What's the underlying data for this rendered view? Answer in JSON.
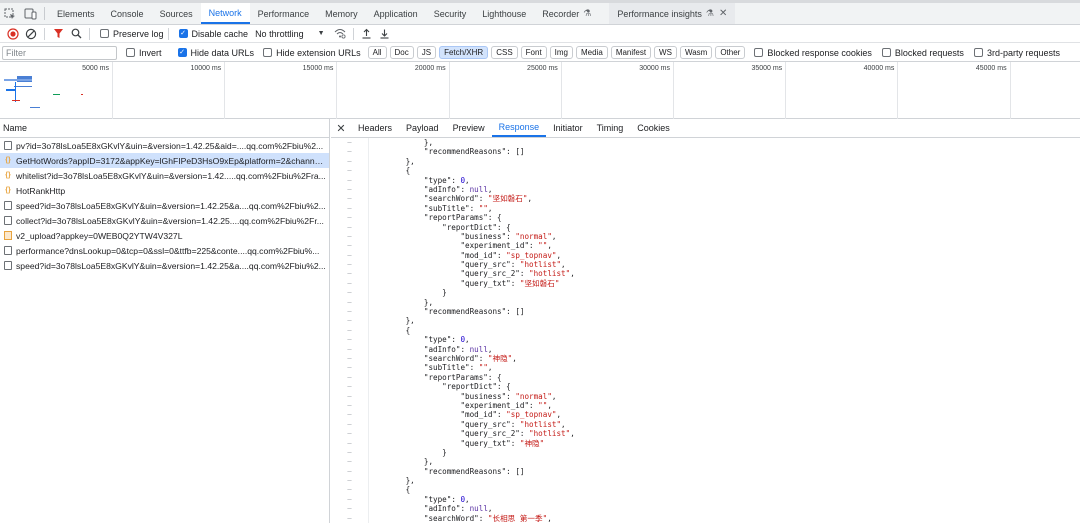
{
  "tabs": [
    {
      "label": "Elements",
      "active": false
    },
    {
      "label": "Console",
      "active": false
    },
    {
      "label": "Sources",
      "active": false
    },
    {
      "label": "Network",
      "active": true
    },
    {
      "label": "Performance",
      "active": false
    },
    {
      "label": "Memory",
      "active": false
    },
    {
      "label": "Application",
      "active": false
    },
    {
      "label": "Security",
      "active": false
    },
    {
      "label": "Lighthouse",
      "active": false
    },
    {
      "label": "Recorder",
      "active": false
    }
  ],
  "pinned_tab": {
    "label": "Performance insights"
  },
  "toolbar": {
    "preserve_log": "Preserve log",
    "disable_cache": "Disable cache",
    "throttling": "No throttling"
  },
  "filterbar": {
    "placeholder": "Filter",
    "invert": "Invert",
    "hide_data_urls": "Hide data URLs",
    "hide_extension_urls": "Hide extension URLs",
    "types": [
      "All",
      "Doc",
      "JS",
      "Fetch/XHR",
      "CSS",
      "Font",
      "Img",
      "Media",
      "Manifest",
      "WS",
      "Wasm",
      "Other"
    ],
    "active_type": "Fetch/XHR",
    "blocked_response_cookies": "Blocked response cookies",
    "blocked_requests": "Blocked requests",
    "third_party": "3rd-party requests"
  },
  "overview": {
    "ticks": [
      "5000 ms",
      "10000 ms",
      "15000 ms",
      "20000 ms",
      "25000 ms",
      "30000 ms",
      "35000 ms",
      "40000 ms",
      "45000 ms"
    ]
  },
  "requests": {
    "header": "Name",
    "items": [
      {
        "name": "pv?id=3o78lsLoa5E8xGKvlY&uin=&version=1.42.25&aid=....qq.com%2Fbiu%2...",
        "icon": "doc",
        "selected": false
      },
      {
        "name": "GetHotWords?appID=3172&appKey=lGhFIPeD3HsO9xEp&platform=2&channell...",
        "icon": "json",
        "selected": true
      },
      {
        "name": "whitelist?id=3o78lsLoa5E8xGKvlY&uin=&version=1.42.....qq.com%2Fbiu%2Fra...",
        "icon": "json",
        "selected": false
      },
      {
        "name": "HotRankHttp",
        "icon": "json",
        "selected": false
      },
      {
        "name": "speed?id=3o78lsLoa5E8xGKvlY&uin=&version=1.42.25&a....qq.com%2Fbiu%2...",
        "icon": "doc",
        "selected": false
      },
      {
        "name": "collect?id=3o78lsLoa5E8xGKvlY&uin=&version=1.42.25....qq.com%2Fbiu%2Fr...",
        "icon": "doc",
        "selected": false
      },
      {
        "name": "v2_upload?appkey=0WEB0Q2YTW4V327L",
        "icon": "img",
        "selected": false
      },
      {
        "name": "performance?dnsLookup=0&tcp=0&ssl=0&ttfb=225&conte....qq.com%2Fbiu%...",
        "icon": "doc",
        "selected": false
      },
      {
        "name": "speed?id=3o78lsLoa5E8xGKvlY&uin=&version=1.42.25&a....qq.com%2Fbiu%2...",
        "icon": "doc",
        "selected": false
      }
    ]
  },
  "detail_tabs": [
    {
      "label": "Headers",
      "active": false
    },
    {
      "label": "Payload",
      "active": false
    },
    {
      "label": "Preview",
      "active": false
    },
    {
      "label": "Response",
      "active": true
    },
    {
      "label": "Initiator",
      "active": false
    },
    {
      "label": "Timing",
      "active": false
    },
    {
      "label": "Cookies",
      "active": false
    }
  ],
  "response": {
    "gutter_mark": "–",
    "lines": [
      [
        [
          12,
          ""
        ],
        [
          "p",
          "},"
        ]
      ],
      [
        [
          12,
          ""
        ],
        [
          "k",
          "\"recommendReasons\""
        ],
        [
          "p",
          ": []"
        ]
      ],
      [
        [
          8,
          ""
        ],
        [
          "p",
          "},"
        ]
      ],
      [
        [
          8,
          ""
        ],
        [
          "p",
          "{"
        ]
      ],
      [
        [
          12,
          ""
        ],
        [
          "k",
          "\"type\""
        ],
        [
          "p",
          ": "
        ],
        [
          "n",
          "0"
        ],
        [
          "p",
          ","
        ]
      ],
      [
        [
          12,
          ""
        ],
        [
          "k",
          "\"adInfo\""
        ],
        [
          "p",
          ": "
        ],
        [
          "nl",
          "null"
        ],
        [
          "p",
          ","
        ]
      ],
      [
        [
          12,
          ""
        ],
        [
          "k",
          "\"searchWord\""
        ],
        [
          "p",
          ": "
        ],
        [
          "s",
          "\"坚如磐石\""
        ],
        [
          "p",
          ","
        ]
      ],
      [
        [
          12,
          ""
        ],
        [
          "k",
          "\"subTitle\""
        ],
        [
          "p",
          ": "
        ],
        [
          "s",
          "\"\""
        ],
        [
          "p",
          ","
        ]
      ],
      [
        [
          12,
          ""
        ],
        [
          "k",
          "\"reportParams\""
        ],
        [
          "p",
          ": {"
        ]
      ],
      [
        [
          16,
          ""
        ],
        [
          "k",
          "\"reportDict\""
        ],
        [
          "p",
          ": {"
        ]
      ],
      [
        [
          20,
          ""
        ],
        [
          "k",
          "\"business\""
        ],
        [
          "p",
          ": "
        ],
        [
          "s",
          "\"normal\""
        ],
        [
          "p",
          ","
        ]
      ],
      [
        [
          20,
          ""
        ],
        [
          "k",
          "\"experiment_id\""
        ],
        [
          "p",
          ": "
        ],
        [
          "s",
          "\"\""
        ],
        [
          "p",
          ","
        ]
      ],
      [
        [
          20,
          ""
        ],
        [
          "k",
          "\"mod_id\""
        ],
        [
          "p",
          ": "
        ],
        [
          "s",
          "\"sp_topnav\""
        ],
        [
          "p",
          ","
        ]
      ],
      [
        [
          20,
          ""
        ],
        [
          "k",
          "\"query_src\""
        ],
        [
          "p",
          ": "
        ],
        [
          "s",
          "\"hotlist\""
        ],
        [
          "p",
          ","
        ]
      ],
      [
        [
          20,
          ""
        ],
        [
          "k",
          "\"query_src_2\""
        ],
        [
          "p",
          ": "
        ],
        [
          "s",
          "\"hotlist\""
        ],
        [
          "p",
          ","
        ]
      ],
      [
        [
          20,
          ""
        ],
        [
          "k",
          "\"query_txt\""
        ],
        [
          "p",
          ": "
        ],
        [
          "s",
          "\"坚如磐石\""
        ]
      ],
      [
        [
          16,
          ""
        ],
        [
          "p",
          "}"
        ]
      ],
      [
        [
          12,
          ""
        ],
        [
          "p",
          "},"
        ]
      ],
      [
        [
          12,
          ""
        ],
        [
          "k",
          "\"recommendReasons\""
        ],
        [
          "p",
          ": []"
        ]
      ],
      [
        [
          8,
          ""
        ],
        [
          "p",
          "},"
        ]
      ],
      [
        [
          8,
          ""
        ],
        [
          "p",
          "{"
        ]
      ],
      [
        [
          12,
          ""
        ],
        [
          "k",
          "\"type\""
        ],
        [
          "p",
          ": "
        ],
        [
          "n",
          "0"
        ],
        [
          "p",
          ","
        ]
      ],
      [
        [
          12,
          ""
        ],
        [
          "k",
          "\"adInfo\""
        ],
        [
          "p",
          ": "
        ],
        [
          "nl",
          "null"
        ],
        [
          "p",
          ","
        ]
      ],
      [
        [
          12,
          ""
        ],
        [
          "k",
          "\"searchWord\""
        ],
        [
          "p",
          ": "
        ],
        [
          "s",
          "\"神隐\""
        ],
        [
          "p",
          ","
        ]
      ],
      [
        [
          12,
          ""
        ],
        [
          "k",
          "\"subTitle\""
        ],
        [
          "p",
          ": "
        ],
        [
          "s",
          "\"\""
        ],
        [
          "p",
          ","
        ]
      ],
      [
        [
          12,
          ""
        ],
        [
          "k",
          "\"reportParams\""
        ],
        [
          "p",
          ": {"
        ]
      ],
      [
        [
          16,
          ""
        ],
        [
          "k",
          "\"reportDict\""
        ],
        [
          "p",
          ": {"
        ]
      ],
      [
        [
          20,
          ""
        ],
        [
          "k",
          "\"business\""
        ],
        [
          "p",
          ": "
        ],
        [
          "s",
          "\"normal\""
        ],
        [
          "p",
          ","
        ]
      ],
      [
        [
          20,
          ""
        ],
        [
          "k",
          "\"experiment_id\""
        ],
        [
          "p",
          ": "
        ],
        [
          "s",
          "\"\""
        ],
        [
          "p",
          ","
        ]
      ],
      [
        [
          20,
          ""
        ],
        [
          "k",
          "\"mod_id\""
        ],
        [
          "p",
          ": "
        ],
        [
          "s",
          "\"sp_topnav\""
        ],
        [
          "p",
          ","
        ]
      ],
      [
        [
          20,
          ""
        ],
        [
          "k",
          "\"query_src\""
        ],
        [
          "p",
          ": "
        ],
        [
          "s",
          "\"hotlist\""
        ],
        [
          "p",
          ","
        ]
      ],
      [
        [
          20,
          ""
        ],
        [
          "k",
          "\"query_src_2\""
        ],
        [
          "p",
          ": "
        ],
        [
          "s",
          "\"hotlist\""
        ],
        [
          "p",
          ","
        ]
      ],
      [
        [
          20,
          ""
        ],
        [
          "k",
          "\"query_txt\""
        ],
        [
          "p",
          ": "
        ],
        [
          "s",
          "\"神隐\""
        ]
      ],
      [
        [
          16,
          ""
        ],
        [
          "p",
          "}"
        ]
      ],
      [
        [
          12,
          ""
        ],
        [
          "p",
          "},"
        ]
      ],
      [
        [
          12,
          ""
        ],
        [
          "k",
          "\"recommendReasons\""
        ],
        [
          "p",
          ": []"
        ]
      ],
      [
        [
          8,
          ""
        ],
        [
          "p",
          "},"
        ]
      ],
      [
        [
          8,
          ""
        ],
        [
          "p",
          "{"
        ]
      ],
      [
        [
          12,
          ""
        ],
        [
          "k",
          "\"type\""
        ],
        [
          "p",
          ": "
        ],
        [
          "n",
          "0"
        ],
        [
          "p",
          ","
        ]
      ],
      [
        [
          12,
          ""
        ],
        [
          "k",
          "\"adInfo\""
        ],
        [
          "p",
          ": "
        ],
        [
          "nl",
          "null"
        ],
        [
          "p",
          ","
        ]
      ],
      [
        [
          12,
          ""
        ],
        [
          "k",
          "\"searchWord\""
        ],
        [
          "p",
          ": "
        ],
        [
          "s",
          "\"长相思 第一季\""
        ],
        [
          "p",
          ","
        ]
      ]
    ]
  },
  "colors": {
    "accent": "#1a73e8",
    "selected_row": "#cfe1fc",
    "string": "#c41a16",
    "number": "#1c00cf",
    "record": "#d93025",
    "filter_icon": "#d93025"
  },
  "icons": {
    "inspect": "inspect-element-icon",
    "device": "device-toolbar-icon",
    "record": "record-stop-icon",
    "clear": "clear-icon",
    "filter": "filter-icon",
    "search": "search-icon",
    "wifi": "network-conditions-icon",
    "import": "import-har-icon",
    "export": "export-har-icon",
    "recorder": "flask-icon",
    "close": "close-icon"
  }
}
